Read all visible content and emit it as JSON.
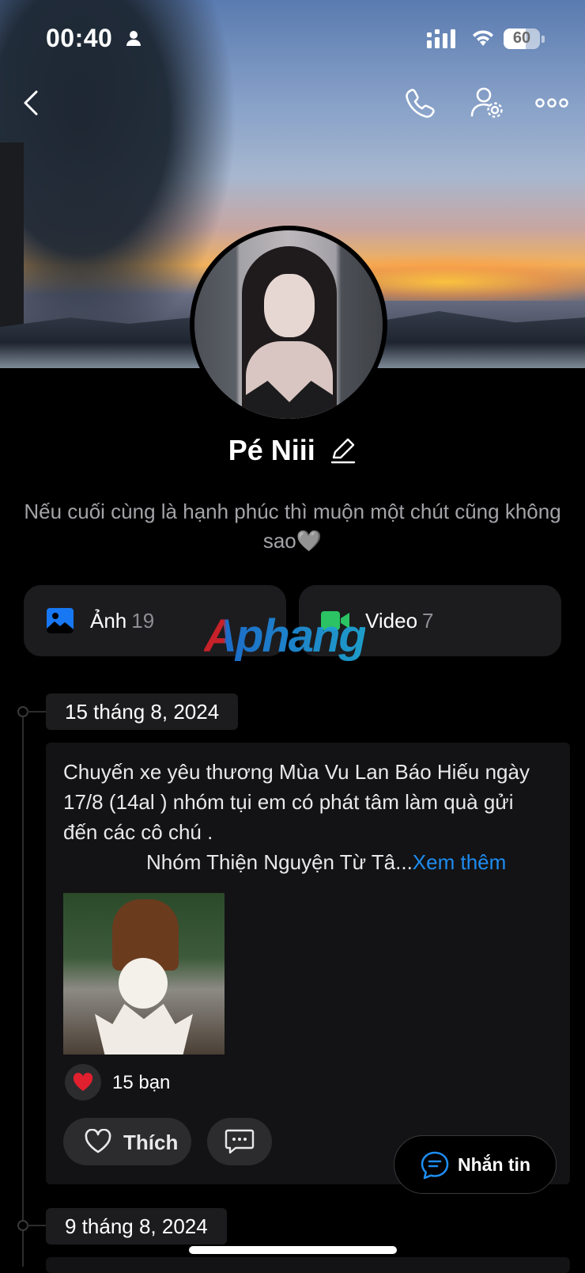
{
  "status_bar": {
    "time": "00:40",
    "battery": "60"
  },
  "profile": {
    "name": "Pé Niii",
    "bio": "Nếu cuối cùng là hạnh phúc thì muộn một chút cũng không sao🩶"
  },
  "media": {
    "photos_label": "Ảnh",
    "photos_count": "19",
    "videos_label": "Video",
    "videos_count": "7"
  },
  "watermark": "Aphang",
  "timeline": [
    {
      "date": "15 tháng 8, 2024",
      "text_line1": "Chuyến xe yêu thương Mùa Vu Lan Báo Hiếu ngày 17/8 (14al ) nhóm tụi em có phát tâm làm quà gửi đến các cô chú .",
      "text_line2": "Nhóm Thiện Nguyện Từ Tâ...",
      "see_more": "Xem thêm",
      "reaction_count": "15 bạn",
      "like_label": "Thích"
    },
    {
      "date": "9 tháng 8, 2024"
    }
  ],
  "message_button": "Nhắn tin",
  "colors": {
    "accent_blue": "#1e8cf0",
    "photo_icon": "#1877f2",
    "video_icon": "#2bc363",
    "heart": "#e0202e"
  }
}
